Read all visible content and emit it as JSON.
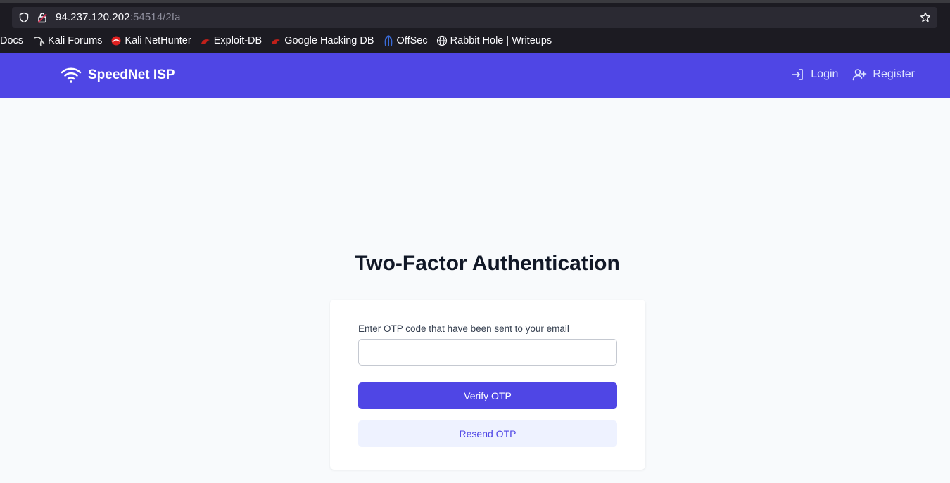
{
  "browser": {
    "url_host": "94.237.120.202",
    "url_rest": ":54514/2fa",
    "bookmarks": [
      {
        "label": "Docs",
        "icon": "none"
      },
      {
        "label": "Kali Forums",
        "icon": "kali-dragon-icon"
      },
      {
        "label": "Kali NetHunter",
        "icon": "nethunter-icon"
      },
      {
        "label": "Exploit-DB",
        "icon": "exploitdb-icon"
      },
      {
        "label": "Google Hacking DB",
        "icon": "ghdb-icon"
      },
      {
        "label": "OffSec",
        "icon": "offsec-icon"
      },
      {
        "label": "Rabbit Hole | Writeups",
        "icon": "globe-icon"
      }
    ]
  },
  "nav": {
    "brand": "SpeedNet ISP",
    "login": "Login",
    "register": "Register"
  },
  "main": {
    "title": "Two-Factor Authentication",
    "otp_label": "Enter OTP code that have been sent to your email",
    "otp_value": "",
    "verify_label": "Verify OTP",
    "resend_label": "Resend OTP"
  },
  "colors": {
    "primary": "#4f46e5",
    "resend_bg": "#eef2ff",
    "page_bg": "#f8fafc"
  }
}
